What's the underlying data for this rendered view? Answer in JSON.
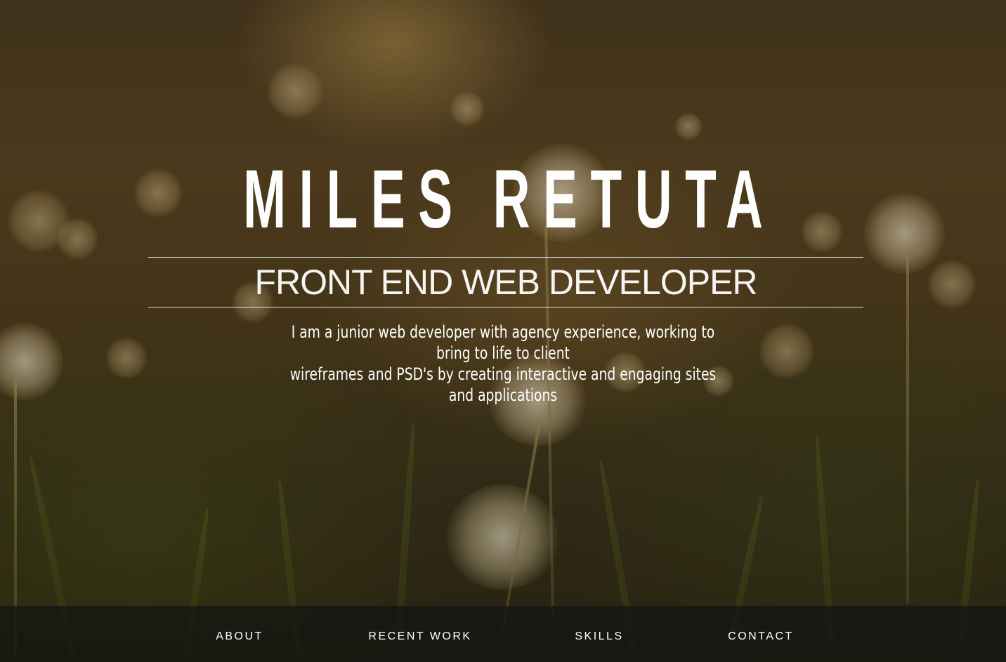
{
  "hero": {
    "name": "MILES RETUTA",
    "title": "FRONT END WEB DEVELOPER",
    "bio_line1": "I am a junior web developer with agency experience, working to bring to life to client",
    "bio_line2": "wireframes and PSD's by creating interactive and engaging sites and applications"
  },
  "nav": {
    "items": [
      {
        "label": "ABOUT"
      },
      {
        "label": "RECENT WORK"
      },
      {
        "label": "SKILLS"
      },
      {
        "label": "CONTACT"
      }
    ]
  },
  "colors": {
    "text": "#ffffff",
    "navbar_bg": "#141412",
    "background_tone": "#4a3a20"
  }
}
